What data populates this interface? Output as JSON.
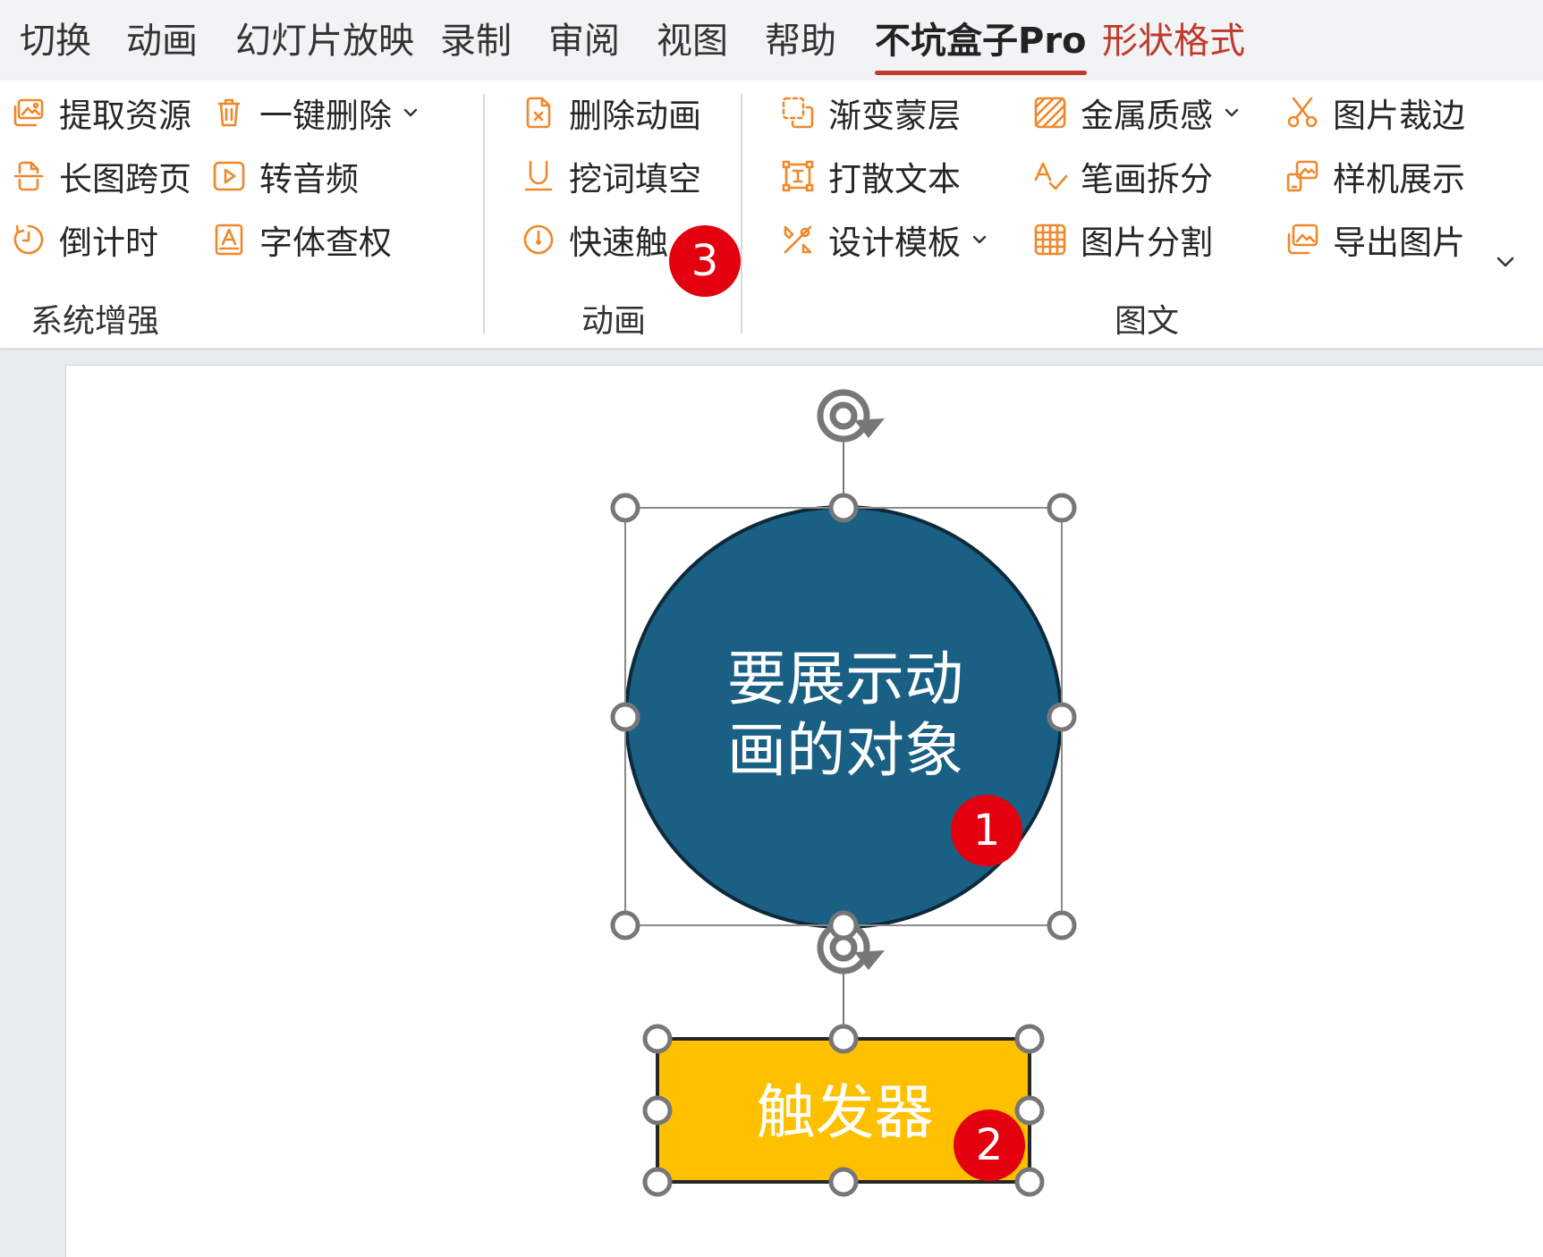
{
  "tabs": [
    {
      "label": "切换"
    },
    {
      "label": "动画"
    },
    {
      "label": "幻灯片放映"
    },
    {
      "label": "录制"
    },
    {
      "label": "审阅"
    },
    {
      "label": "视图"
    },
    {
      "label": "帮助"
    },
    {
      "label": "不坑盒子Pro",
      "state": "active"
    },
    {
      "label": "形状格式",
      "state": "contextual"
    }
  ],
  "ribbon": {
    "groups": [
      {
        "label": "系统增强",
        "items": [
          {
            "label": "提取资源",
            "icon": "image-extract-icon"
          },
          {
            "label": "一键删除",
            "icon": "trash-icon",
            "dropdown": true
          },
          {
            "label": "长图跨页",
            "icon": "long-image-icon"
          },
          {
            "label": "转音频",
            "icon": "play-icon"
          },
          {
            "label": "倒计时",
            "icon": "timer-icon"
          },
          {
            "label": "字体查权",
            "icon": "font-check-icon"
          }
        ]
      },
      {
        "label": "动画",
        "items": [
          {
            "label": "删除动画",
            "icon": "delete-animation-icon"
          },
          {
            "label": "挖词填空",
            "icon": "underline-icon"
          },
          {
            "label": "快速触",
            "icon": "quick-trigger-icon"
          }
        ]
      },
      {
        "label": "图文",
        "items": [
          {
            "label": "渐变蒙层",
            "icon": "gradient-mask-icon"
          },
          {
            "label": "金属质感",
            "icon": "metal-texture-icon",
            "dropdown": true
          },
          {
            "label": "图片裁边",
            "icon": "scissors-icon"
          },
          {
            "label": "打散文本",
            "icon": "split-text-icon"
          },
          {
            "label": "笔画拆分",
            "icon": "stroke-split-icon"
          },
          {
            "label": "样机展示",
            "icon": "mockup-icon"
          },
          {
            "label": "设计模板",
            "icon": "design-template-icon",
            "dropdown": true
          },
          {
            "label": "图片分割",
            "icon": "grid-icon"
          },
          {
            "label": "导出图片",
            "icon": "export-image-icon"
          }
        ]
      }
    ]
  },
  "slide": {
    "circle_text": "要展示动\n画的对象",
    "rect_text": "触发器",
    "circle_fill": "#1a5f84",
    "rect_fill": "#ffc000"
  },
  "badges": [
    "1",
    "2",
    "3"
  ],
  "colors": {
    "accent": "#c0392b",
    "icon_orange": "#f0882a",
    "badge_red": "#e3000f"
  }
}
